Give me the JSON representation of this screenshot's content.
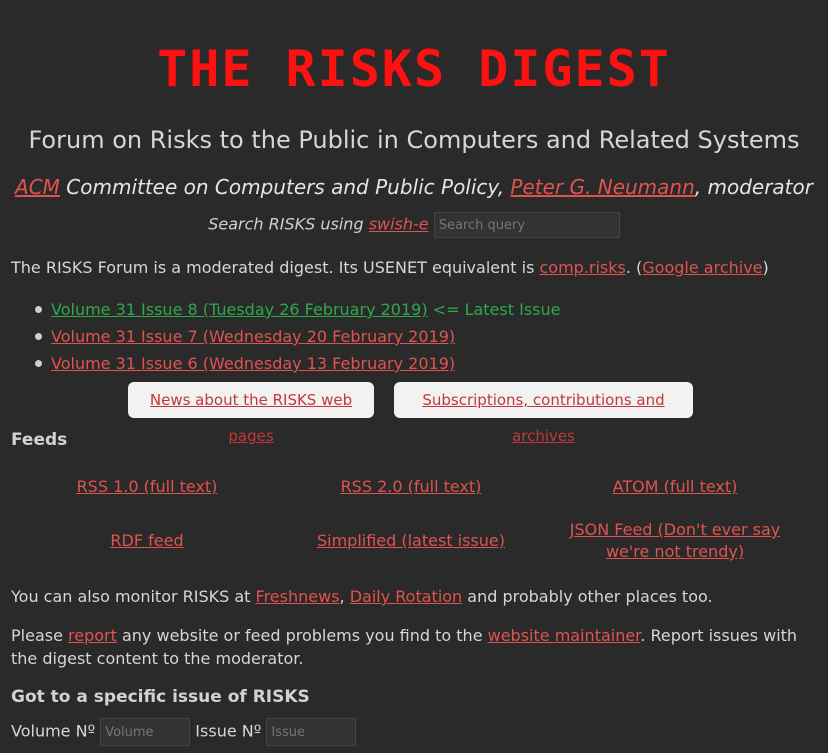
{
  "header": {
    "title": "THE RISKS DIGEST",
    "subtitle": "Forum on Risks to the Public in Computers and Related Systems",
    "acm_link": "ACM",
    "committee_text": " Committee on Computers and Public Policy, ",
    "moderator_link": "Peter G. Neumann",
    "moderator_suffix": ", moderator"
  },
  "search": {
    "prefix": "Search RISKS using ",
    "engine_link": "swish-e",
    "placeholder": "Search query"
  },
  "intro": {
    "text": "The RISKS Forum is a moderated digest. Its USENET equivalent is ",
    "usenet_link": "comp.risks",
    "mid": ". (",
    "archive_link": "Google archive",
    "end": ")"
  },
  "issues": [
    {
      "label": "Volume 31 Issue 8 (Tuesday 26 February 2019)",
      "tag": " <= Latest Issue"
    },
    {
      "label": "Volume 31 Issue 7 (Wednesday 20 February 2019)"
    },
    {
      "label": "Volume 31 Issue 6 (Wednesday 13 February 2019)"
    }
  ],
  "buttons": {
    "news": "News about the RISKS web pages",
    "subscriptions": "Subscriptions, contributions and archives"
  },
  "feeds": {
    "heading": "Feeds",
    "rss1": "RSS 1.0 (full text)",
    "rss2": "RSS 2.0 (full text)",
    "atom": "ATOM (full text)",
    "rdf": "RDF feed",
    "simplified": "Simplified (latest issue)",
    "json": "JSON Feed (Don't ever say we're not trendy)"
  },
  "monitor": {
    "prefix": "You can also monitor RISKS at ",
    "freshnews": "Freshnews",
    "comma": ", ",
    "daily": "Daily Rotation",
    "suffix": " and probably other places too."
  },
  "report": {
    "prefix": "Please ",
    "report_link": "report",
    "mid": " any website or feed problems you find to the ",
    "maintainer_link": "website maintainer",
    "suffix": ". Report issues with the digest content to the moderator."
  },
  "goto": {
    "heading": "Got to a specific issue of RISKS",
    "volume_label": "Volume Nº",
    "volume_placeholder": "Volume",
    "issue_label": "Issue Nº",
    "issue_placeholder": "Issue"
  }
}
